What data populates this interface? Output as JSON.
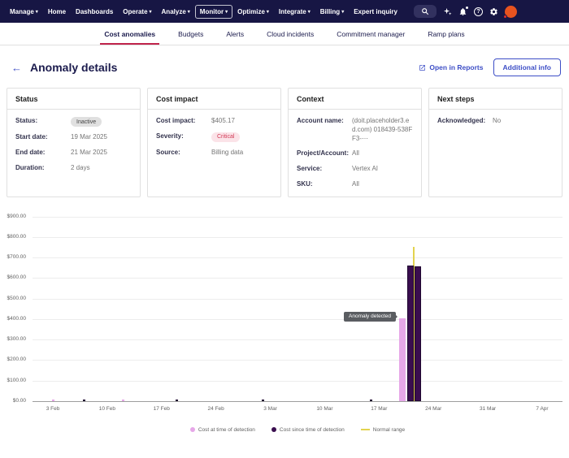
{
  "topnav": {
    "items": [
      {
        "label": "Manage"
      },
      {
        "label": "Home"
      },
      {
        "label": "Dashboards"
      },
      {
        "label": "Operate"
      },
      {
        "label": "Analyze"
      },
      {
        "label": "Monitor"
      },
      {
        "label": "Optimize"
      },
      {
        "label": "Integrate"
      },
      {
        "label": "Billing"
      },
      {
        "label": "Expert inquiry"
      }
    ],
    "icons": [
      "search-icon",
      "ai-sparkle-icon",
      "bell-icon",
      "help-icon",
      "gear-icon",
      "avatar"
    ]
  },
  "tabs": [
    {
      "label": "Cost anomalies"
    },
    {
      "label": "Budgets"
    },
    {
      "label": "Alerts"
    },
    {
      "label": "Cloud incidents"
    },
    {
      "label": "Commitment manager"
    },
    {
      "label": "Ramp plans"
    }
  ],
  "header": {
    "title": "Anomaly details",
    "open_in_reports": "Open in Reports",
    "additional_info": "Additional info"
  },
  "cards": [
    {
      "title": "Status",
      "rows": [
        {
          "label": "Status:",
          "value": "Inactive"
        },
        {
          "label": "Start date:",
          "value": "19 Mar 2025"
        },
        {
          "label": "End date:",
          "value": "21 Mar 2025"
        },
        {
          "label": "Duration:",
          "value": "2 days"
        }
      ]
    },
    {
      "title": "Cost impact",
      "rows": [
        {
          "label": "Cost impact:",
          "value": "$405.17"
        },
        {
          "label": "Severity:",
          "value": "Critical"
        },
        {
          "label": "Source:",
          "value": "Billing data"
        }
      ]
    },
    {
      "title": "Context",
      "rows": [
        {
          "label": "Account name:",
          "value": "(doit.placeholder3.ed.com) 018439-538FF3-⋯"
        },
        {
          "label": "Project/Account:",
          "value": "All"
        },
        {
          "label": "Service:",
          "value": "Vertex AI"
        },
        {
          "label": "SKU:",
          "value": "All"
        }
      ]
    },
    {
      "title": "Next steps",
      "rows": [
        {
          "label": "Acknowledged:",
          "value": "No"
        }
      ]
    }
  ],
  "colors": {
    "nav_bg": "#171644",
    "accent_red": "#c0244c",
    "primary_blue": "#3d4ec6",
    "bar_pink": "#e6a7e8",
    "bar_purple": "#3a0e4f",
    "normal_yellow": "#e3d34f"
  },
  "chart_data": {
    "type": "bar",
    "title": "",
    "xlabel": "",
    "ylabel": "",
    "ylim": [
      0,
      900
    ],
    "grid": true,
    "legend_position": "bottom",
    "yticks": [
      "$0.00",
      "$100.00",
      "$200.00",
      "$300.00",
      "$400.00",
      "$500.00",
      "$600.00",
      "$700.00",
      "$800.00",
      "$900.00"
    ],
    "xticks": [
      {
        "label": "3 Feb",
        "day": 0
      },
      {
        "label": "10 Feb",
        "day": 7
      },
      {
        "label": "17 Feb",
        "day": 14
      },
      {
        "label": "24 Feb",
        "day": 21
      },
      {
        "label": "3 Mar",
        "day": 28
      },
      {
        "label": "10 Mar",
        "day": 35
      },
      {
        "label": "17 Mar",
        "day": 42
      },
      {
        "label": "24 Mar",
        "day": 49
      },
      {
        "label": "31 Mar",
        "day": 56
      },
      {
        "label": "7 Apr",
        "day": 63
      }
    ],
    "x_range_days": [
      0,
      63
    ],
    "series": [
      {
        "name": "Cost at time of detection",
        "type": "bar",
        "color": "#e6a7e8",
        "points": [
          {
            "day": 0,
            "value": 8
          },
          {
            "day": 9,
            "value": 5
          },
          {
            "day": 45,
            "value": 405.17
          }
        ]
      },
      {
        "name": "Cost since time of detection",
        "type": "bar",
        "color": "#3a0e4f",
        "border": "#1f0630",
        "points": [
          {
            "day": 4,
            "value": 6
          },
          {
            "day": 16,
            "value": 4
          },
          {
            "day": 27,
            "value": 6
          },
          {
            "day": 41,
            "value": 5
          },
          {
            "day": 46,
            "value": 662
          },
          {
            "day": 47,
            "value": 656
          }
        ]
      },
      {
        "name": "Normal range",
        "type": "line",
        "color": "#e3d34f",
        "points": [
          {
            "day": 46.5,
            "from": 0,
            "to": 752
          }
        ]
      }
    ],
    "annotation": {
      "label": "Anomaly detected",
      "day": 45,
      "value": 405
    }
  }
}
